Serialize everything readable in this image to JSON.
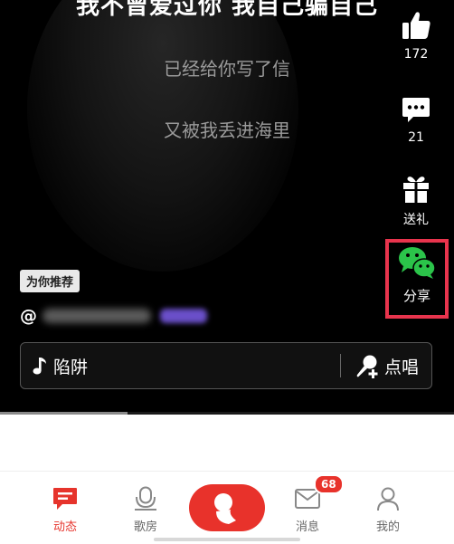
{
  "lyrics": {
    "line1": "我不曾爱过你 我自己骗自己",
    "line2": "已经给你写了信",
    "line3": "又被我丢进海里"
  },
  "right_rail": {
    "like_count": "172",
    "comment_count": "21",
    "gift_label": "送礼",
    "share_label": "分享"
  },
  "recommend_tag": "为你推荐",
  "user_prefix": "@",
  "song": {
    "title": "陷阱",
    "sing_label": "点唱"
  },
  "progress": {
    "fraction": 0.28
  },
  "nav": {
    "items": [
      {
        "label": "动态"
      },
      {
        "label": "歌房"
      },
      {
        "label": "消息"
      },
      {
        "label": "我的"
      }
    ],
    "message_badge": "68"
  },
  "colors": {
    "accent": "#e8322b",
    "highlight_border": "#e8344d",
    "wechat_green": "#2bc44a"
  }
}
